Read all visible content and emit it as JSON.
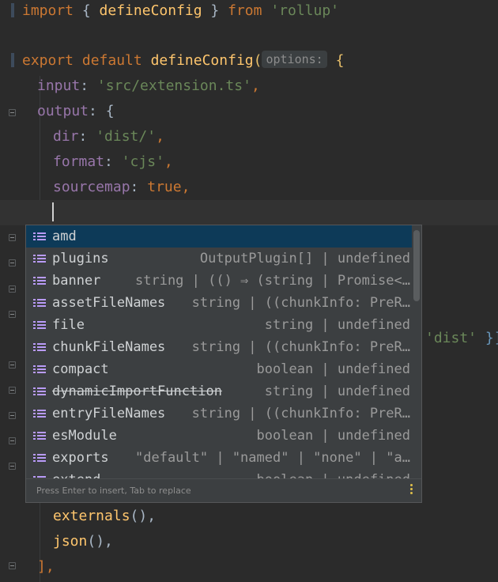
{
  "code": {
    "line1": {
      "kw_import": "import",
      "open": " { ",
      "name": "defineConfig",
      "close": " } ",
      "kw_from": "from",
      "space": " ",
      "module": "'rollup'"
    },
    "line2": {
      "kw_export": "export",
      "kw_default": "default",
      "fn": "defineConfig",
      "paren": "(",
      "param_hint": "options:",
      "brace": "{"
    },
    "line3": {
      "prop": "input",
      "colon": ": ",
      "value": "'src/extension.ts'",
      "comma": ","
    },
    "line4": {
      "prop": "output",
      "rest": ": {"
    },
    "line5": {
      "prop": "dir",
      "colon": ": ",
      "value": "'dist/'",
      "comma": ","
    },
    "line6": {
      "prop": "format",
      "colon": ": ",
      "value": "'cjs'",
      "comma": ","
    },
    "line7": {
      "prop": "sourcemap",
      "colon": ": ",
      "value": "true",
      "comma": ","
    },
    "behind_popup": {
      "value": "'dist'",
      "close": " }]"
    },
    "line_ext": {
      "call": "externals",
      "rest": "(),"
    },
    "line_json": {
      "call": "json",
      "rest": "(),"
    },
    "line_close": {
      "text": "],"
    }
  },
  "completion": {
    "items": [
      {
        "name": "amd",
        "type": ""
      },
      {
        "name": "plugins",
        "type": "OutputPlugin[] | undefined"
      },
      {
        "name": "banner",
        "type": "string | (() ⇒ (string | Promise<…"
      },
      {
        "name": "assetFileNames",
        "type": "string | ((chunkInfo: PreR…"
      },
      {
        "name": "file",
        "type": "string | undefined"
      },
      {
        "name": "chunkFileNames",
        "type": "string | ((chunkInfo: PreR…"
      },
      {
        "name": "compact",
        "type": "boolean | undefined"
      },
      {
        "name": "dynamicImportFunction",
        "type": "string | undefined"
      },
      {
        "name": "entryFileNames",
        "type": "string | ((chunkInfo: PreR…"
      },
      {
        "name": "esModule",
        "type": "boolean | undefined"
      },
      {
        "name": "exports",
        "type": "\"default\" | \"named\" | \"none\" | \"a…"
      },
      {
        "name": "extend",
        "type": "boolean | undefined"
      }
    ],
    "footer_hint": "Press Enter to insert, Tab to replace",
    "icon": "property-list-icon",
    "more_icon": "kebab-menu-icon"
  }
}
